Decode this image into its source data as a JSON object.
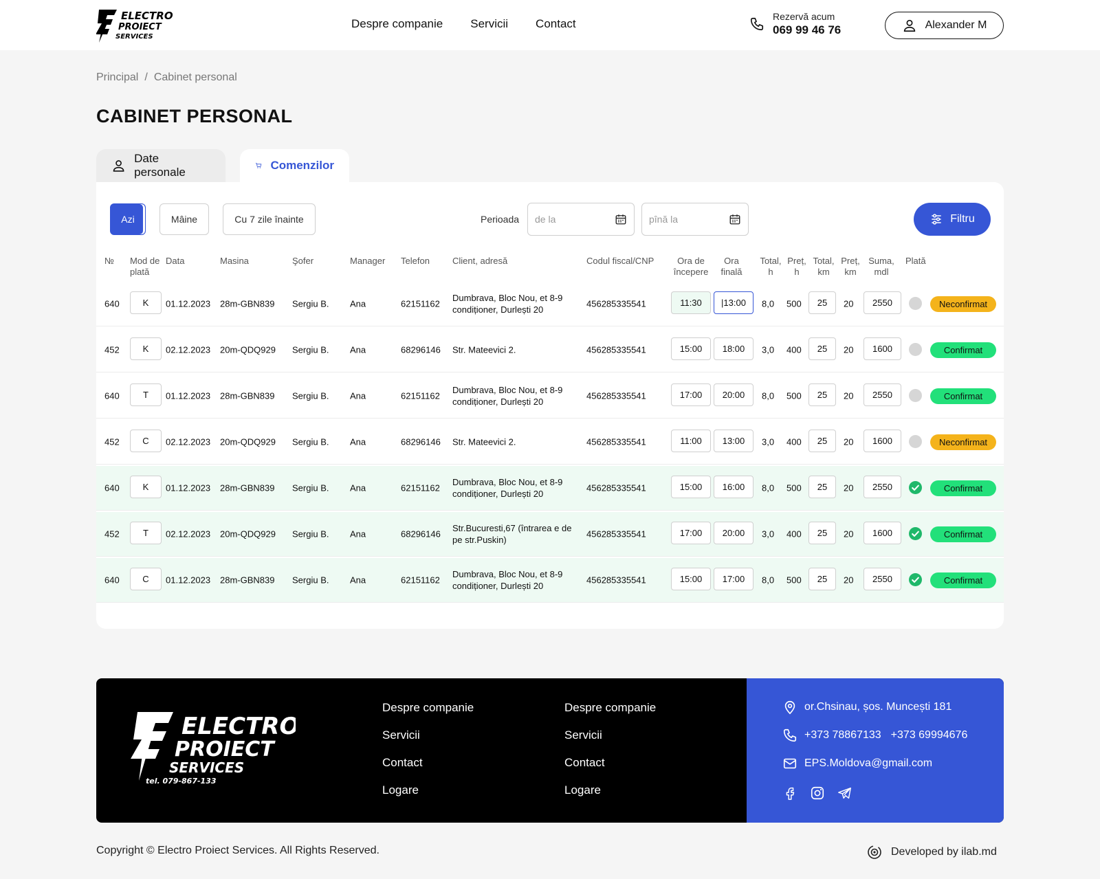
{
  "header": {
    "brand": "ELECTRO PROIECT SERVICES",
    "nav": [
      "Despre companie",
      "Servicii",
      "Contact"
    ],
    "book_label": "Rezervă acum",
    "book_phone": "069 99 46 76",
    "user_name": "Alexander M"
  },
  "breadcrumb": {
    "home": "Principal",
    "separator": "/",
    "current": "Cabinet personal"
  },
  "page_title": "CABINET PERSONAL",
  "tabs": {
    "personal": "Date personale",
    "orders": "Comenzilor"
  },
  "filters": {
    "today": "Azi",
    "tomorrow": "Mâine",
    "week_before": "Cu 7 zile înainte",
    "period_label": "Perioada",
    "from_placeholder": "de la",
    "to_placeholder": "pînă la",
    "filter_button": "Filtru"
  },
  "table": {
    "headers": {
      "nr": "№",
      "payment_mode": "Mod de plată",
      "date": "Data",
      "car": "Masina",
      "driver": "Şofer",
      "manager": "Manager",
      "phone": "Telefon",
      "client": "Client, adresă",
      "fiscal": "Codul fiscal/CNP",
      "start": "Ora de începere",
      "end": "Ora finală",
      "total_h": "Total, h",
      "price_h": "Preț, h",
      "total_km": "Total, km",
      "price_km": "Preț, km",
      "sum": "Suma, mdl",
      "paid": "Plată"
    },
    "rows": [
      {
        "nr": "640",
        "mode": "K",
        "date": "01.12.2023",
        "car": "28m-GBN839",
        "driver": "Sergiu B.",
        "manager": "Ana",
        "phone": "62151162",
        "client": "Dumbrava, Bloc Nou, et 8-9 condiționer, Durlești 20",
        "fiscal": "456285335541",
        "start": "11:30",
        "end": "|13:00",
        "total_h": "8,0",
        "price_h": "500",
        "total_km": "25",
        "price_km": "20",
        "sum": "2550",
        "paid": false,
        "status": "Neconfirmat",
        "status_color": "#f4b31b"
      },
      {
        "nr": "452",
        "mode": "K",
        "date": "02.12.2023",
        "car": "20m-QDQ929",
        "driver": "Sergiu B.",
        "manager": "Ana",
        "phone": "68296146",
        "client": "Str. Mateevici 2.",
        "fiscal": "456285335541",
        "start": "15:00",
        "end": "18:00",
        "total_h": "3,0",
        "price_h": "400",
        "total_km": "25",
        "price_km": "20",
        "sum": "1600",
        "paid": false,
        "status": "Confirmat",
        "status_color": "#22e07a"
      },
      {
        "nr": "640",
        "mode": "T",
        "date": "01.12.2023",
        "car": "28m-GBN839",
        "driver": "Sergiu B.",
        "manager": "Ana",
        "phone": "62151162",
        "client": "Dumbrava, Bloc Nou, et 8-9 condiționer, Durlești 20",
        "fiscal": "456285335541",
        "start": "17:00",
        "end": "20:00",
        "total_h": "8,0",
        "price_h": "500",
        "total_km": "25",
        "price_km": "20",
        "sum": "2550",
        "paid": false,
        "status": "Confirmat",
        "status_color": "#22e07a"
      },
      {
        "nr": "452",
        "mode": "C",
        "date": "02.12.2023",
        "car": "20m-QDQ929",
        "driver": "Sergiu B.",
        "manager": "Ana",
        "phone": "68296146",
        "client": "Str. Mateevici 2.",
        "fiscal": "456285335541",
        "start": "11:00",
        "end": "13:00",
        "total_h": "3,0",
        "price_h": "400",
        "total_km": "25",
        "price_km": "20",
        "sum": "1600",
        "paid": false,
        "status": "Neconfirmat",
        "status_color": "#f4b31b"
      },
      {
        "nr": "640",
        "mode": "K",
        "date": "01.12.2023",
        "car": "28m-GBN839",
        "driver": "Sergiu B.",
        "manager": "Ana",
        "phone": "62151162",
        "client": "Dumbrava, Bloc Nou, et 8-9 condiționer, Durlești 20",
        "fiscal": "456285335541",
        "start": "15:00",
        "end": "16:00",
        "total_h": "8,0",
        "price_h": "500",
        "total_km": "25",
        "price_km": "20",
        "sum": "2550",
        "paid": true,
        "status": "Confirmat",
        "status_color": "#22e07a"
      },
      {
        "nr": "452",
        "mode": "T",
        "date": "02.12.2023",
        "car": "20m-QDQ929",
        "driver": "Sergiu B.",
        "manager": "Ana",
        "phone": "68296146",
        "client": "Str.Bucuresti,67 (întrarea e de pe str.Puskin)",
        "fiscal": "456285335541",
        "start": "17:00",
        "end": "20:00",
        "total_h": "3,0",
        "price_h": "400",
        "total_km": "25",
        "price_km": "20",
        "sum": "1600",
        "paid": true,
        "status": "Confirmat",
        "status_color": "#22e07a"
      },
      {
        "nr": "640",
        "mode": "C",
        "date": "01.12.2023",
        "car": "28m-GBN839",
        "driver": "Sergiu B.",
        "manager": "Ana",
        "phone": "62151162",
        "client": "Dumbrava, Bloc Nou, et 8-9 condiționer, Durlești 20",
        "fiscal": "456285335541",
        "start": "15:00",
        "end": "17:00",
        "total_h": "8,0",
        "price_h": "500",
        "total_km": "25",
        "price_km": "20",
        "sum": "2550",
        "paid": true,
        "status": "Confirmat",
        "status_color": "#22e07a"
      }
    ]
  },
  "footer": {
    "logo_phone": "tel. 079-867-133",
    "col1": [
      "Despre companie",
      "Servicii",
      "Contact",
      "Logare"
    ],
    "col2": [
      "Despre companie",
      "Servicii",
      "Contact",
      "Logare"
    ],
    "address": "or.Chsinau, șos. Muncești 181",
    "phone1": "+373 78867133",
    "phone2": "+373 69994676",
    "email": "EPS.Moldova@gmail.com",
    "socials": [
      "facebook-icon",
      "instagram-icon",
      "telegram-icon"
    ]
  },
  "copyright": "Copyright © Electro Proiect Services. All Rights Reserved.",
  "developer": "Developed by ilab.md",
  "colors": {
    "accent": "#3656d6",
    "confirmed": "#22e07a",
    "unconfirmed": "#f4b31b",
    "paid_row": "#eefaf3"
  }
}
